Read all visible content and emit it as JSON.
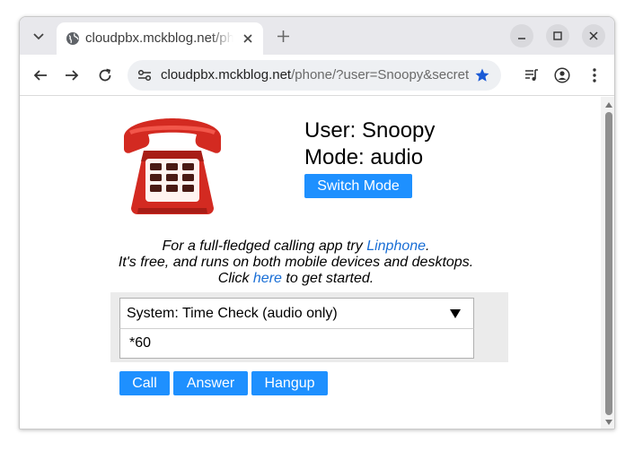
{
  "browser": {
    "tab": {
      "title": "cloudpbx.mckblog.net/phone/?user=Snoopy"
    },
    "address_bar": {
      "url_host": "cloudpbx.mckblog.net",
      "url_path": "/phone/?user=Snoopy&secret…"
    },
    "icons": {
      "tab_menu": "chevron-down-icon",
      "favicon": "globe-icon",
      "tab_close": "close-icon",
      "new_tab": "plus-icon",
      "minimize": "minimize-icon",
      "maximize": "maximize-icon",
      "close_window": "close-icon",
      "back": "back-arrow-icon",
      "forward": "forward-arrow-icon",
      "reload": "reload-icon",
      "site_info": "tune-icon",
      "bookmark": "star-icon",
      "media": "media-queue-icon",
      "profile": "profile-icon",
      "menu": "kebab-menu-icon"
    }
  },
  "app": {
    "user_label": "User: Snoopy",
    "mode_label": "Mode: audio",
    "switch_mode_label": "Switch Mode",
    "promo": {
      "line1_prefix": "For a full-fledged calling app try ",
      "line1_link": "Linphone",
      "line1_suffix": ".",
      "line2": "It's free, and runs on both mobile devices and desktops.",
      "line3_prefix": "Click ",
      "line3_link": "here",
      "line3_suffix": " to get started."
    },
    "destination_select": {
      "selected": "System: Time Check (audio only)"
    },
    "number_input": {
      "value": "*60"
    },
    "buttons": {
      "call": "Call",
      "answer": "Answer",
      "hangup": "Hangup"
    }
  },
  "colors": {
    "accent": "#1e90ff",
    "link": "#1a6fd6",
    "bookmark_star": "#1a5ad6",
    "phone_red": "#d32a21"
  }
}
